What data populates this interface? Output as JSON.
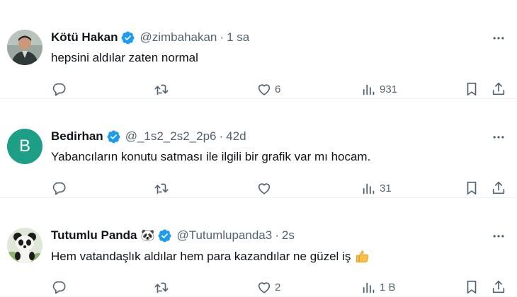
{
  "posts": [
    {
      "name": "Kötü Hakan",
      "emoji": "",
      "handle": "@zimbahakan",
      "separator": "·",
      "time": "1 sa",
      "text": "hepsini aldılar zaten normal",
      "likes": "6",
      "views": "931",
      "avatar_letter": "",
      "avatar_icon": "person-photo-avatar"
    },
    {
      "name": "Bedirhan",
      "emoji": "",
      "handle": "@_1s2_2s2_2p6",
      "separator": "·",
      "time": "42d",
      "text": "Yabancıların konutu satması ile ilgili bir grafik var mı hocam.",
      "likes": "",
      "views": "31",
      "avatar_letter": "B",
      "avatar_icon": "letter-avatar"
    },
    {
      "name": "Tutumlu Panda",
      "emoji": "🐼",
      "handle": "@Tutumlupanda3",
      "separator": "·",
      "time": "2s",
      "text": "Hem vatandaşlık aldılar hem para kazandılar ne güzel iş",
      "likes": "2",
      "views": "1 B",
      "avatar_letter": "",
      "avatar_icon": "panda-avatar"
    }
  ],
  "colors": {
    "secondary_text": "#536471",
    "verified_blue": "#1d9bf0",
    "avatar_b_bg": "#1d9e86",
    "divider": "#eff3f4"
  }
}
